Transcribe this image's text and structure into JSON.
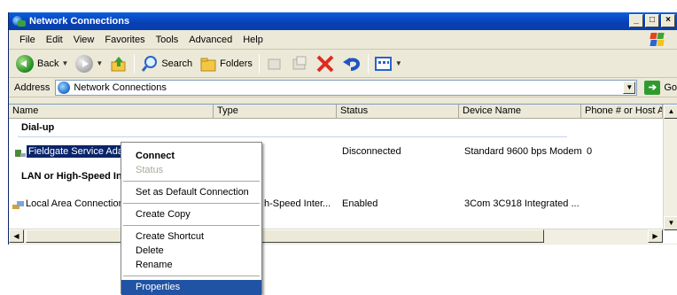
{
  "window": {
    "title": "Network Connections",
    "buttons": {
      "minimize": "_",
      "maximize": "□",
      "close": "×"
    }
  },
  "menu": [
    "File",
    "Edit",
    "View",
    "Favorites",
    "Tools",
    "Advanced",
    "Help"
  ],
  "toolbar": {
    "back_label": "Back",
    "search_label": "Search",
    "folders_label": "Folders"
  },
  "address": {
    "label": "Address",
    "value": "Network Connections",
    "go_label": "Go"
  },
  "columns": [
    "Name",
    "Type",
    "Status",
    "Device Name",
    "Phone # or Host Ad"
  ],
  "groups": {
    "dialup": "Dial-up",
    "lan": "LAN or High-Speed Internet"
  },
  "rows": [
    {
      "name": "Fieldgate Service Adapter",
      "type": "",
      "status": "Disconnected",
      "device": "Standard  9600 bps Modem",
      "phone": "0"
    },
    {
      "name": "Local Area Connection",
      "type": "LAN or High-Speed Internet",
      "status": "Enabled",
      "device": "3Com 3C918 Integrated ...",
      "phone": ""
    }
  ],
  "visible": {
    "row0_name": "Fieldgate Service Adap",
    "lan_group": "LAN or High-Speed In",
    "row1_name": "Local Area Connection",
    "row1_type": "h-Speed Inter..."
  },
  "context_menu": {
    "items": [
      {
        "label": "Connect",
        "style": "bold"
      },
      {
        "label": "Status",
        "style": "disabled"
      },
      {
        "label": "Set as Default Connection",
        "style": "normal"
      },
      {
        "label": "Create Copy",
        "style": "normal"
      },
      {
        "label": "Create Shortcut",
        "style": "normal"
      },
      {
        "label": "Delete",
        "style": "normal"
      },
      {
        "label": "Rename",
        "style": "normal"
      },
      {
        "label": "Properties",
        "style": "highlighted"
      }
    ]
  },
  "colors": {
    "titlebar": "#0a3fb5",
    "selection": "#0a246a",
    "menu_highlight": "#2153a5"
  }
}
